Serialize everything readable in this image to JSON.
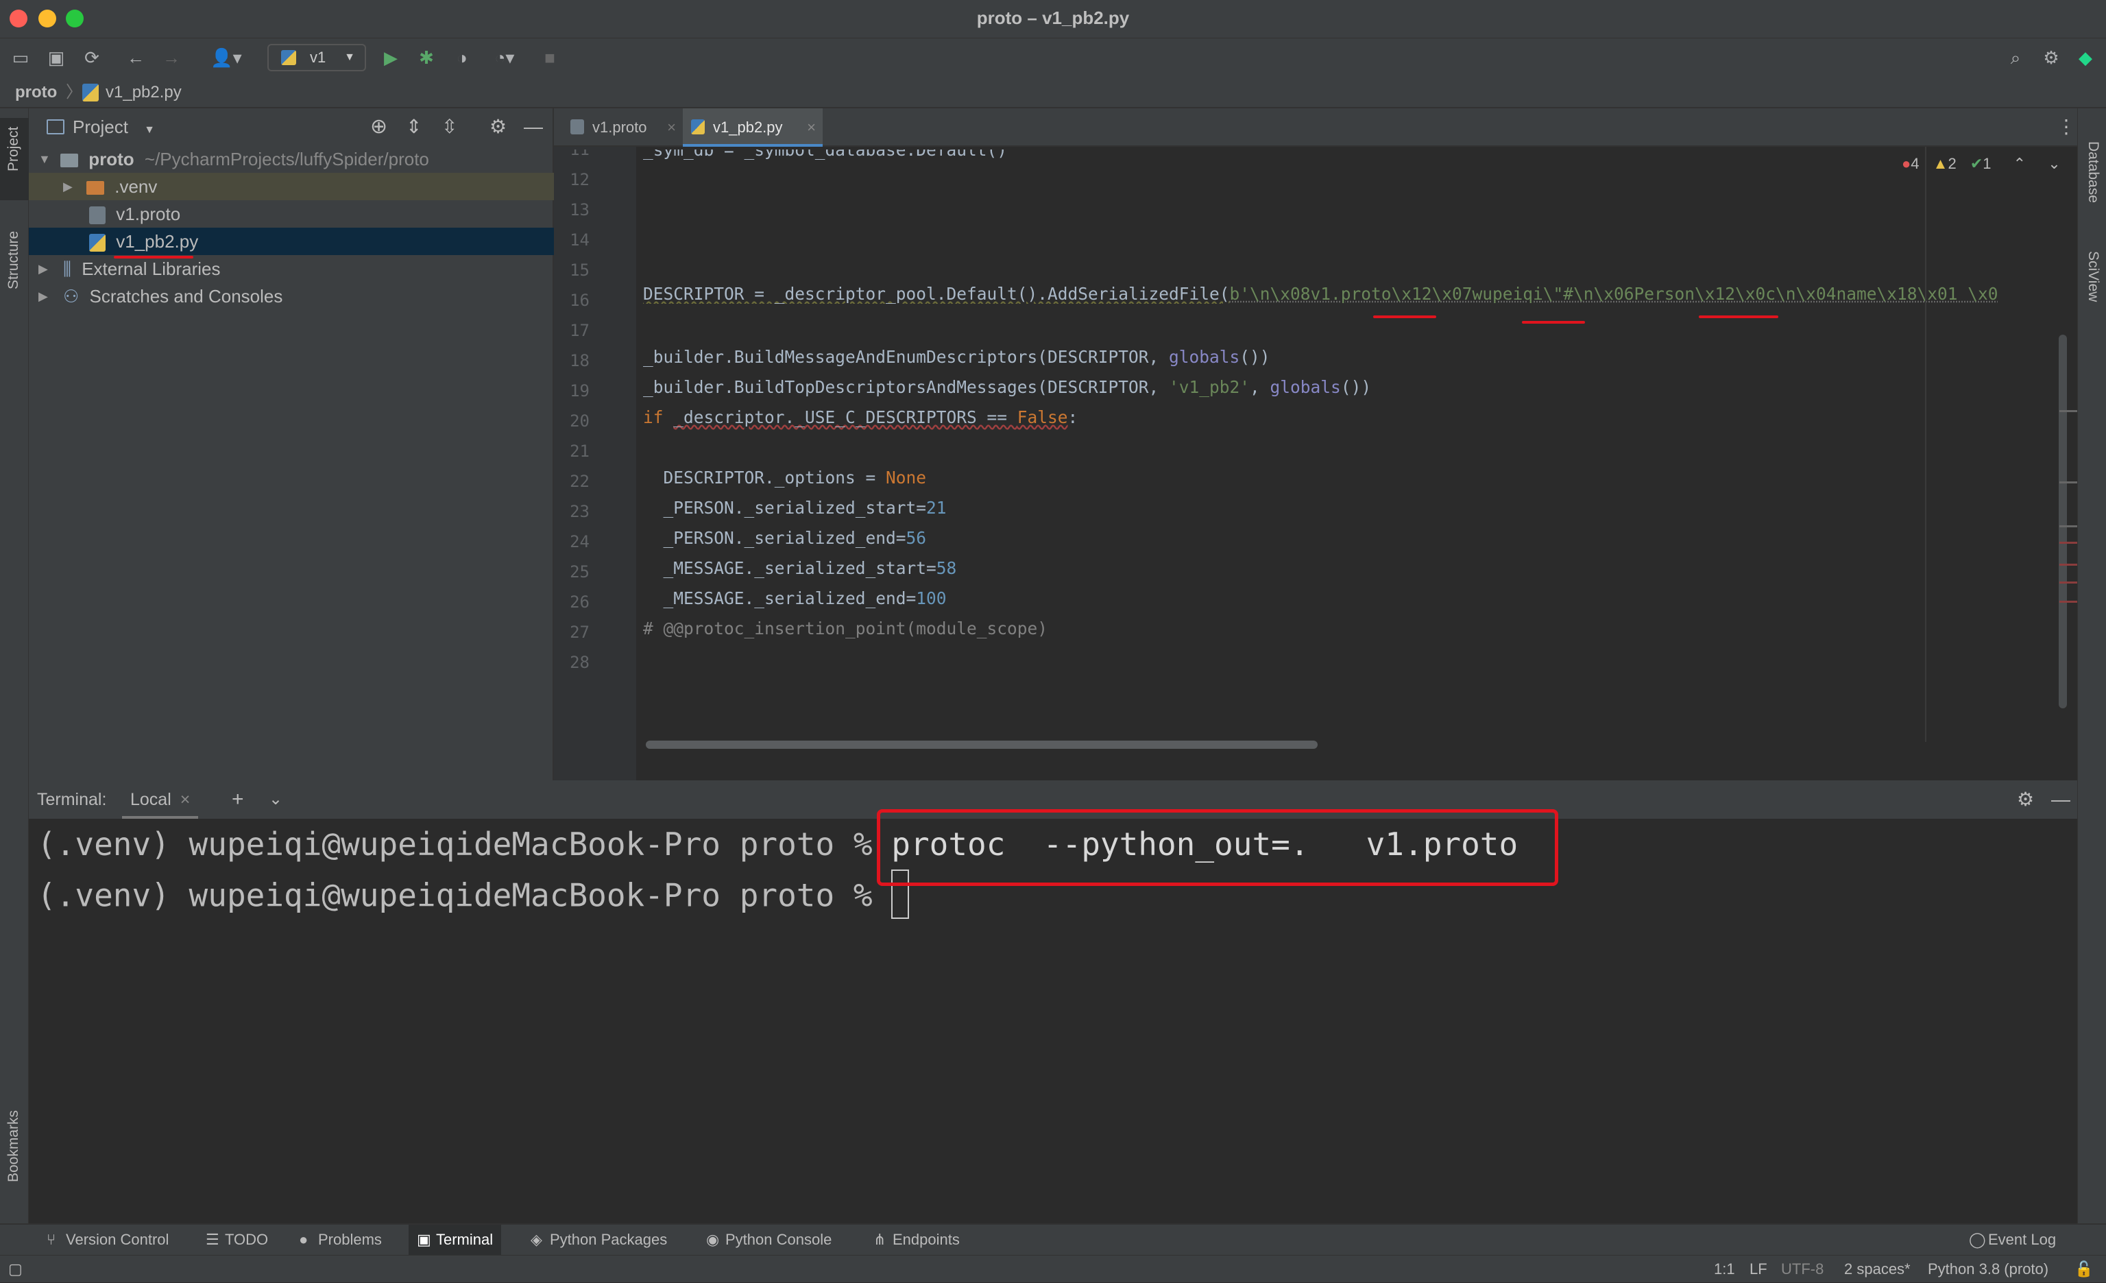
{
  "window": {
    "title": "proto – v1_pb2.py"
  },
  "toolbar": {
    "run_config": "v1"
  },
  "breadcrumb": {
    "project": "proto",
    "file": "v1_pb2.py"
  },
  "left_stripe": {
    "project": "Project",
    "structure": "Structure",
    "bookmarks": "Bookmarks"
  },
  "right_stripe": {
    "database": "Database",
    "sciview": "SciView"
  },
  "project_panel": {
    "title": "Project",
    "root": {
      "name": "proto",
      "path": "~/PycharmProjects/luffySpider/proto"
    },
    "items": [
      {
        "label": ".venv"
      },
      {
        "label": "v1.proto"
      },
      {
        "label": "v1_pb2.py"
      },
      {
        "label": "External Libraries"
      },
      {
        "label": "Scratches and Consoles"
      }
    ]
  },
  "editor": {
    "tabs": [
      {
        "label": "v1.proto"
      },
      {
        "label": "v1_pb2.py"
      }
    ],
    "inspections": {
      "errors": "4",
      "warnings": "2",
      "ok": "1"
    },
    "line_numbers": [
      "11",
      "12",
      "13",
      "14",
      "15",
      "16",
      "17",
      "18",
      "19",
      "20",
      "21",
      "22",
      "23",
      "24",
      "25",
      "26",
      "27",
      "28"
    ],
    "lines": {
      "l11": "_sym_db = _symbol_database.Default()",
      "l16a": "DESCRIPTOR = _descriptor_pool.Default().AddSerializedFile(",
      "l16b": "b'\\n\\x08v1.proto\\x12\\x07wupeiqi\\\"#\\n\\x06Person\\x12\\x0c\\n\\x04name\\x18\\x01 \\x0",
      "l18a": "_builder.BuildMessageAndEnumDescriptors(DESCRIPTOR, ",
      "l18b": "globals",
      "l18c": "())",
      "l19a": "_builder.BuildTopDescriptorsAndMessages(DESCRIPTOR, ",
      "l19b": "'v1_pb2'",
      "l19c": ", ",
      "l19d": "globals",
      "l19e": "())",
      "l20a": "if ",
      "l20b": "_descriptor._USE_C_DESCRIPTORS == ",
      "l20c": "False",
      "l20d": ":",
      "l22a": "  DESCRIPTOR._options = ",
      "l22b": "None",
      "l23a": "  _PERSON._serialized_start=",
      "l23b": "21",
      "l24a": "  _PERSON._serialized_end=",
      "l24b": "56",
      "l25a": "  _MESSAGE._serialized_start=",
      "l25b": "58",
      "l26a": "  _MESSAGE._serialized_end=",
      "l26b": "100",
      "l27": "# @@protoc_insertion_point(module_scope)"
    }
  },
  "terminal": {
    "label": "Terminal:",
    "tab": "Local",
    "line1_prompt": "(.venv) wupeiqi@wupeiqideMacBook-Pro proto % ",
    "line1_cmd": "protoc  --python_out=.   v1.proto",
    "line2_prompt": "(.venv) wupeiqi@wupeiqideMacBook-Pro proto % "
  },
  "bottom_tools": [
    {
      "label": "Version Control"
    },
    {
      "label": "TODO"
    },
    {
      "label": "Problems"
    },
    {
      "label": "Terminal"
    },
    {
      "label": "Python Packages"
    },
    {
      "label": "Python Console"
    },
    {
      "label": "Endpoints"
    }
  ],
  "event_log": "Event Log",
  "status": {
    "position": "1:1",
    "line_sep": "LF",
    "encoding": "UTF-8",
    "indent": "2 spaces*",
    "interpreter": "Python 3.8 (proto)"
  },
  "colors": {
    "accent": "#4a88c7",
    "annotation_red": "#e0141e",
    "run_green": "#59a869"
  }
}
